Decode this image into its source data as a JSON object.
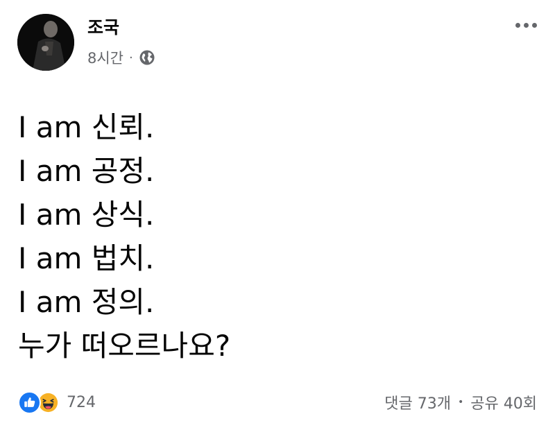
{
  "author": {
    "name": "조국",
    "time": "8시간",
    "separator": "·",
    "privacy_icon": "globe-icon"
  },
  "post": {
    "lines": [
      "I am 신뢰.",
      "I am 공정.",
      "I am 상식.",
      "I am 법치.",
      "I am 정의.",
      "누가 떠오르나요?"
    ]
  },
  "reactions": {
    "icons": [
      "like-icon",
      "haha-icon"
    ],
    "count": "724"
  },
  "stats": {
    "comments": "댓글 73개",
    "separator": "•",
    "shares": "공유 40회"
  },
  "colors": {
    "text": "#050505",
    "secondary_text": "#65676b",
    "like_blue": "#1877f2",
    "haha_yellow": "#f7b125"
  }
}
